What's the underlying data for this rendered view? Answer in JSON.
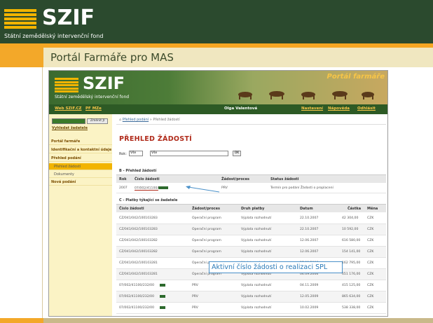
{
  "slide": {
    "logo_text": "SZIF",
    "logo_subtitle": "Státní zemědělský intervenční fond",
    "title": "Portál Farmáře pro MAS"
  },
  "portal": {
    "logo_text": "SZIF",
    "logo_subtitle": "Státní zemědělský intervenční fond",
    "portal_name": "Portál farmáře",
    "nav": {
      "web_link": "Web SZIF.CZ",
      "pf_link": "PF MZe",
      "user": "Olga Valentová",
      "settings": "Nastavení",
      "help": "Nápověda",
      "logout": "Odhlásit"
    },
    "sidebar": {
      "change_button": "Změnit JI",
      "search_link": "Vyhledat žadatele",
      "items": [
        {
          "label": "Portál farmáře"
        },
        {
          "label": "Identifikační a kontaktní údaje"
        },
        {
          "label": "Přehled podání"
        },
        {
          "label": "Přehled žádostí"
        },
        {
          "label": "Dokumenty"
        },
        {
          "label": "Nová podání"
        }
      ]
    },
    "breadcrumb": {
      "home": "Přehled podání",
      "sep": "»",
      "current": "Přehled žádostí"
    },
    "heading": "PŘEHLED ŽÁDOSTÍ",
    "filter": {
      "label": "Rok:",
      "year_value": "Vše",
      "type_value": "Vše",
      "ok": "OK"
    },
    "section_b": {
      "title": "B - Přehled žádostí",
      "headers": [
        "Rok",
        "Číslo žádosti",
        "Žádost/proces",
        "Status žádosti"
      ],
      "rows": [
        [
          "2007",
          "07/002/41100/",
          "PRV",
          "Termín pro podání Žádosti o proplacení"
        ]
      ]
    },
    "section_c": {
      "title": "C - Platby týkající se žadatele",
      "headers": [
        "Číslo žádosti",
        "Žádost/proces",
        "Druh platby",
        "Datum",
        "Částka",
        "Měna"
      ],
      "rows": [
        [
          "CZ/041/042/100103283",
          "Operační program",
          "Výplata rozhodnutí",
          "22.10.2007",
          "42 304,00",
          "CZK"
        ],
        [
          "CZ/041/042/100103283",
          "Operační program",
          "Výplata rozhodnutí",
          "22.10.2007",
          "10 592,00",
          "CZK"
        ],
        [
          "CZ/041/042/100103282",
          "Operační program",
          "Výplata rozhodnutí",
          "12.06.2007",
          "616 580,00",
          "CZK"
        ],
        [
          "CZ/041/042/100103282",
          "Operační program",
          "Výplata rozhodnutí",
          "12.06.2007",
          "154 141,00",
          "CZK"
        ],
        [
          "CZ/041/042/100103281",
          "Operační program",
          "Výplata rozhodnutí",
          "27.09.2006",
          "162 795,00",
          "CZK"
        ],
        [
          "CZ/041/042/100103281",
          "Operační program",
          "Výplata rozhodnutí",
          "04.09.2006",
          "651 176,00",
          "CZK"
        ],
        [
          "07/002/41100/232/00",
          "PRV",
          "Výplata rozhodnutí",
          "04.11.2009",
          "415 125,00",
          "CZK"
        ],
        [
          "07/002/41100/232/00",
          "PRV",
          "Výplata rozhodnutí",
          "12.05.2009",
          "865 634,00",
          "CZK"
        ],
        [
          "07/002/41100/232/00",
          "PRV",
          "Výplata rozhodnutí",
          "10.02.2009",
          "538 338,00",
          "CZK"
        ]
      ]
    },
    "callout": "Aktivní číslo žádosti o realizaci SPL"
  }
}
